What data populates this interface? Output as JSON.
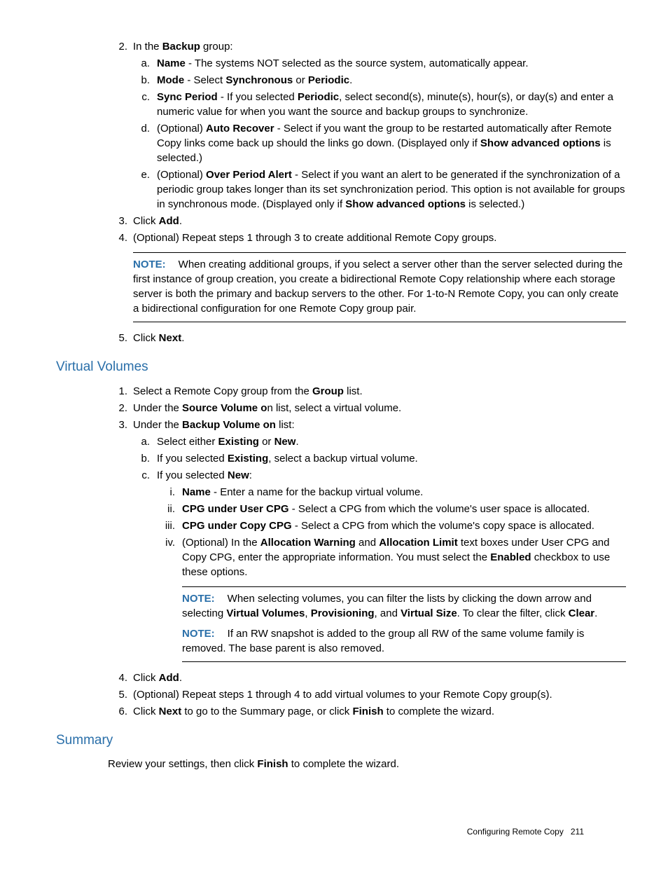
{
  "steps1": {
    "s2": {
      "marker": "2.",
      "intro_a": "In the ",
      "intro_b": "Backup",
      "intro_c": " group:"
    },
    "s2a": {
      "marker": "a.",
      "b1": "Name",
      "t1": " - The systems NOT selected as the source system, automatically appear."
    },
    "s2b": {
      "marker": "b.",
      "b1": "Mode",
      "t1": " - Select ",
      "b2": "Synchronous",
      "t2": " or ",
      "b3": "Periodic",
      "t3": "."
    },
    "s2c": {
      "marker": "c.",
      "b1": "Sync Period",
      "t1": " - If you selected ",
      "b2": "Periodic",
      "t2": ", select second(s), minute(s), hour(s), or day(s) and enter a numeric value for when you want the source and backup groups to synchronize."
    },
    "s2d": {
      "marker": "d.",
      "t0": "(Optional) ",
      "b1": "Auto Recover",
      "t1": " - Select if you want the group to be restarted automatically after Remote Copy links come back up should the links go down. (Displayed only if ",
      "b2": "Show advanced options",
      "t2": " is selected.)"
    },
    "s2e": {
      "marker": "e.",
      "t0": "(Optional) ",
      "b1": "Over Period Alert",
      "t1": " - Select if you want an alert to be generated if the synchronization of a periodic group takes longer than its set synchronization period. This option is not available for groups in synchronous mode. (Displayed only if ",
      "b2": "Show advanced options",
      "t2": " is selected.)"
    },
    "s3": {
      "marker": "3.",
      "t1": "Click ",
      "b1": "Add",
      "t2": "."
    },
    "s4": {
      "marker": "4.",
      "t1": "(Optional) Repeat steps 1 through 3 to create additional Remote Copy groups."
    },
    "note1": {
      "label": "NOTE:",
      "text": "When creating additional groups, if you select a server other than the server selected during the first instance of group creation, you create a bidirectional Remote Copy relationship where each storage server is both the primary and backup servers to the other. For 1-to-N Remote Copy, you can only create a bidirectional configuration for one Remote Copy group pair."
    },
    "s5": {
      "marker": "5.",
      "t1": "Click ",
      "b1": "Next",
      "t2": "."
    }
  },
  "vvHeading": "Virtual Volumes",
  "vv": {
    "s1": {
      "marker": "1.",
      "t1": "Select a Remote Copy group from the ",
      "b1": "Group",
      "t2": " list."
    },
    "s2": {
      "marker": "2.",
      "t1": "Under the ",
      "b1": "Source Volume o",
      "t2": "n list, select a virtual volume."
    },
    "s3": {
      "marker": "3.",
      "t1": "Under the ",
      "b1": "Backup Volume on",
      "t2": " list:"
    },
    "s3a": {
      "marker": "a.",
      "t1": "Select either ",
      "b1": "Existing",
      "t2": " or ",
      "b2": "New",
      "t3": "."
    },
    "s3b": {
      "marker": "b.",
      "t1": "If you selected ",
      "b1": "Existing",
      "t2": ", select a backup virtual volume."
    },
    "s3c": {
      "marker": "c.",
      "t1": "If you selected ",
      "b1": "New",
      "t2": ":"
    },
    "s3ci": {
      "marker": "i.",
      "b1": "Name",
      "t1": " - Enter a name for the backup virtual volume."
    },
    "s3cii": {
      "marker": "ii.",
      "b1": "CPG under User CPG",
      "t1": " - Select a CPG from which the volume's user space is allocated."
    },
    "s3ciii": {
      "marker": "iii.",
      "b1": "CPG under Copy CPG",
      "t1": " - Select a CPG from which the volume's copy space is allocated."
    },
    "s3civ": {
      "marker": "iv.",
      "t0": "(Optional) In the ",
      "b1": "Allocation Warning",
      "t1": " and ",
      "b2": "Allocation Limit",
      "t2": " text boxes under User CPG and Copy CPG, enter the appropriate information. You must select the ",
      "b3": "Enabled",
      "t3": " checkbox to use these options."
    },
    "note2": {
      "label": "NOTE:",
      "t1": "When selecting volumes, you can filter the lists by clicking the down arrow and selecting ",
      "b1": "Virtual Volumes",
      "t2": ", ",
      "b2": "Provisioning",
      "t3": ", and ",
      "b3": "Virtual Size",
      "t4": ". To clear the filter, click ",
      "b4": "Clear",
      "t5": "."
    },
    "note3": {
      "label": "NOTE:",
      "t1": "If an RW snapshot is added to the group all RW of the same volume family is removed. The base parent is also removed."
    },
    "s4": {
      "marker": "4.",
      "t1": "Click ",
      "b1": "Add",
      "t2": "."
    },
    "s5": {
      "marker": "5.",
      "t1": "(Optional) Repeat steps 1 through 4 to add virtual volumes to your Remote Copy group(s)."
    },
    "s6": {
      "marker": "6.",
      "t1": "Click ",
      "b1": "Next",
      "t2": " to go to the Summary page, or click ",
      "b2": "Finish",
      "t3": " to complete the wizard."
    }
  },
  "summaryHeading": "Summary",
  "summary": {
    "t1": "Review your settings, then click ",
    "b1": "Finish",
    "t2": " to complete the wizard."
  },
  "footer": {
    "text": "Configuring Remote Copy",
    "page": "211"
  }
}
